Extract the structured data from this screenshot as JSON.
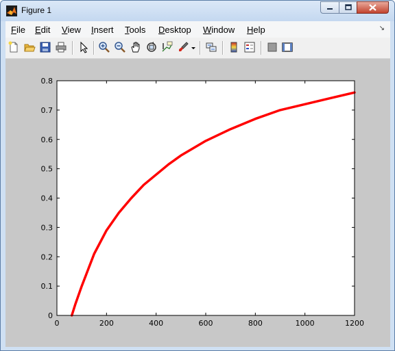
{
  "window": {
    "title": "Figure 1"
  },
  "menu": [
    {
      "key": "file",
      "pre": "",
      "u": "F",
      "post": "ile"
    },
    {
      "key": "edit",
      "pre": "",
      "u": "E",
      "post": "dit"
    },
    {
      "key": "view",
      "pre": "",
      "u": "V",
      "post": "iew"
    },
    {
      "key": "insert",
      "pre": "",
      "u": "I",
      "post": "nsert"
    },
    {
      "key": "tools",
      "pre": "",
      "u": "T",
      "post": "ools"
    },
    {
      "key": "desktop",
      "pre": "",
      "u": "D",
      "post": "esktop"
    },
    {
      "key": "window",
      "pre": "",
      "u": "W",
      "post": "indow"
    },
    {
      "key": "help",
      "pre": "",
      "u": "H",
      "post": "elp"
    }
  ],
  "toolbar": {
    "icons": [
      "new-figure-icon",
      "open-file-icon",
      "save-icon",
      "print-icon",
      "edit-plot-arrow-icon",
      "zoom-in-icon",
      "zoom-out-icon",
      "pan-hand-icon",
      "rotate-3d-icon",
      "data-cursor-icon",
      "brush-icon",
      "brush-dropdown-icon",
      "link-plot-icon",
      "colorbar-icon",
      "legend-icon",
      "hide-plot-tools-icon",
      "show-plot-tools-icon"
    ]
  },
  "chart_data": {
    "type": "line",
    "title": "",
    "xlabel": "",
    "ylabel": "",
    "xlim": [
      0,
      1200
    ],
    "ylim": [
      0,
      0.8
    ],
    "xticks": [
      0,
      200,
      400,
      600,
      800,
      1000,
      1200
    ],
    "yticks": [
      0,
      0.1,
      0.2,
      0.3,
      0.4,
      0.5,
      0.6,
      0.7,
      0.8
    ],
    "x_tick_labels": [
      "0",
      "200",
      "400",
      "600",
      "800",
      "1000",
      "1200"
    ],
    "y_tick_labels": [
      "0",
      "0.1",
      "0.2",
      "0.3",
      "0.4",
      "0.5",
      "0.6",
      "0.7",
      "0.8"
    ],
    "grid": false,
    "series": [
      {
        "color": "#ff0000",
        "x": [
          60,
          75,
          100,
          150,
          200,
          250,
          300,
          350,
          400,
          450,
          500,
          600,
          700,
          800,
          900,
          1000,
          1100,
          1200
        ],
        "y": [
          0,
          0.04,
          0.1,
          0.21,
          0.29,
          0.35,
          0.4,
          0.445,
          0.48,
          0.515,
          0.545,
          0.595,
          0.635,
          0.67,
          0.7,
          0.72,
          0.74,
          0.76
        ]
      }
    ]
  }
}
